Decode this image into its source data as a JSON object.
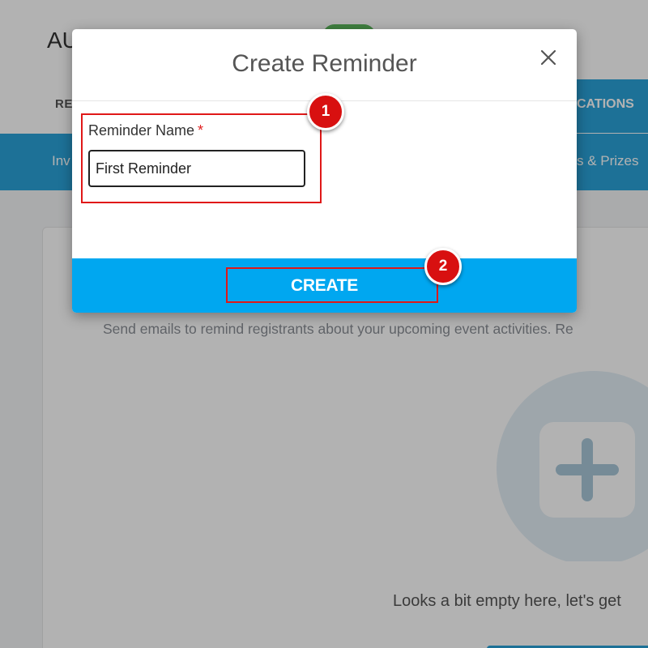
{
  "background": {
    "title_fragment": "AU",
    "tab_left_fragment": "RE",
    "tab_right_fragment": "CATIONS",
    "subnav_left_fragment": "Inv",
    "subnav_right_fragment": "s & Prizes",
    "description": "Send emails to remind registrants about your upcoming event activities. Re",
    "empty_text": "Looks a bit empty here, let's get",
    "colors": {
      "accent": "#2aa3d9",
      "pill": "#5cb85c"
    }
  },
  "modal": {
    "title": "Create Reminder",
    "close_icon": "close-icon",
    "field": {
      "label": "Reminder Name",
      "required_marker": "*",
      "value": "First Reminder"
    },
    "create_label": "CREATE",
    "colors": {
      "footer": "#00a7f0",
      "required": "#e02020"
    }
  },
  "annotations": {
    "step1": "1",
    "step2": "2",
    "color": "#e01818"
  }
}
